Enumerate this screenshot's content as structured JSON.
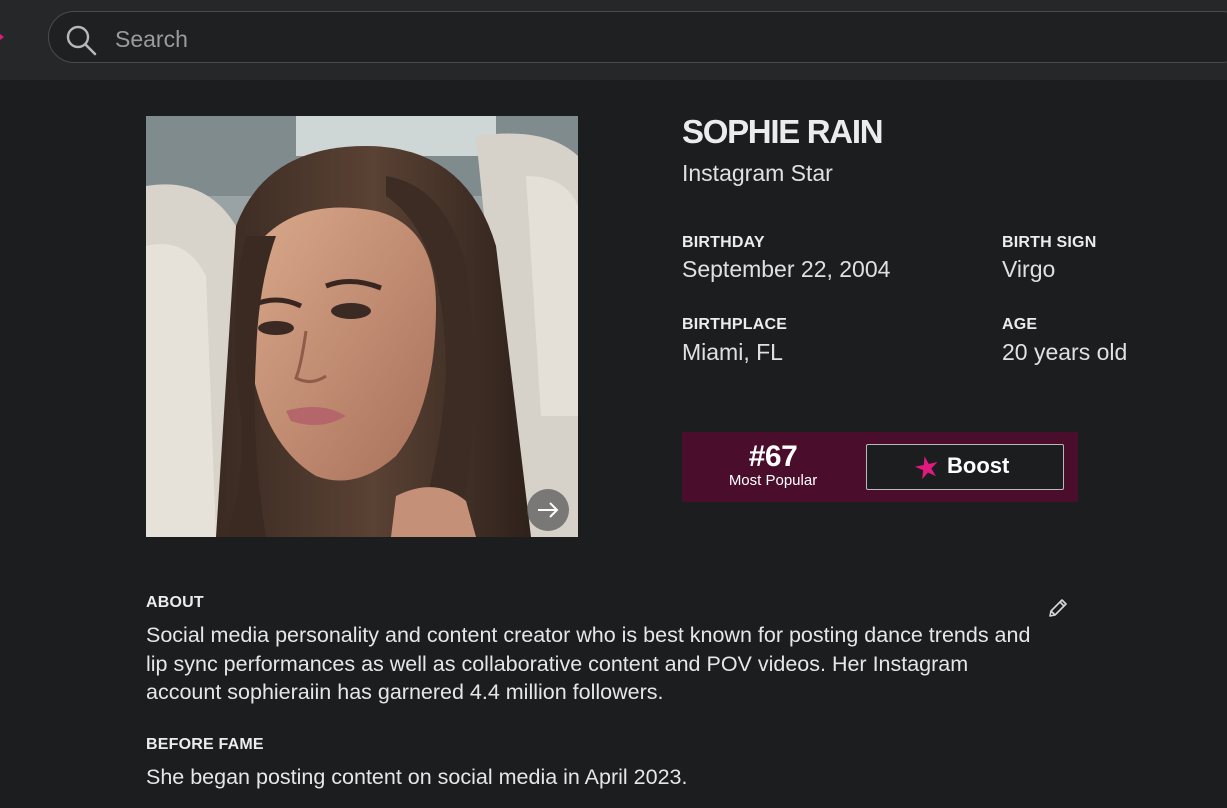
{
  "search": {
    "placeholder": "Search",
    "icon": "search-icon"
  },
  "profile": {
    "name": "SOPHIE RAIN",
    "profession": "Instagram Star",
    "photo_next_icon": "arrow-right-icon",
    "stats": {
      "birthday_label": "BIRTHDAY",
      "birthday_value": "September 22, 2004",
      "birth_sign_label": "BIRTH SIGN",
      "birth_sign_value": "Virgo",
      "birthplace_label": "BIRTHPLACE",
      "birthplace_value": "Miami, FL",
      "age_label": "AGE",
      "age_value": "20 years old"
    },
    "rank": {
      "number": "#67",
      "caption": "Most Popular"
    },
    "boost": {
      "label": "Boost",
      "icon": "star-icon"
    },
    "about": {
      "label": "ABOUT",
      "text": "Social media personality and content creator who is best known for posting dance trends and lip sync performances as well as collaborative content and POV videos. Her Instagram account sophieraiin has garnered 4.4 million followers.",
      "edit_icon": "pencil-icon"
    },
    "before_fame": {
      "label": "BEFORE FAME",
      "text": "She began posting content on social media in April 2023."
    }
  },
  "colors": {
    "page_background": "#1c1d1f",
    "topbar_background": "#262729",
    "rank_panel": "#4a0d2c",
    "accent_pink": "#e0197d"
  }
}
